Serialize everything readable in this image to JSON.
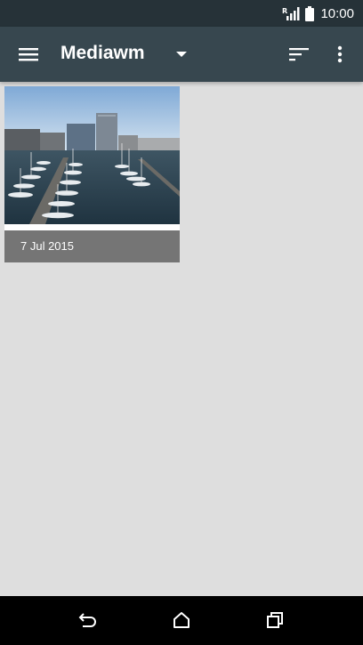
{
  "status_bar": {
    "time": "10:00",
    "icons": [
      "signal-icon",
      "battery-icon"
    ]
  },
  "app_bar": {
    "title": "Mediawm",
    "icons": [
      "menu-icon",
      "dropdown-arrow-icon",
      "sort-icon",
      "more-vert-icon"
    ]
  },
  "gallery": {
    "items": [
      {
        "date": "7 Jul 2015"
      }
    ]
  },
  "nav_bar": {
    "icons": [
      "back-icon",
      "home-icon",
      "recents-icon"
    ]
  },
  "colors": {
    "status_bar": "#263238",
    "app_bar": "#37474f",
    "background": "#dedede",
    "caption": "#757575"
  }
}
